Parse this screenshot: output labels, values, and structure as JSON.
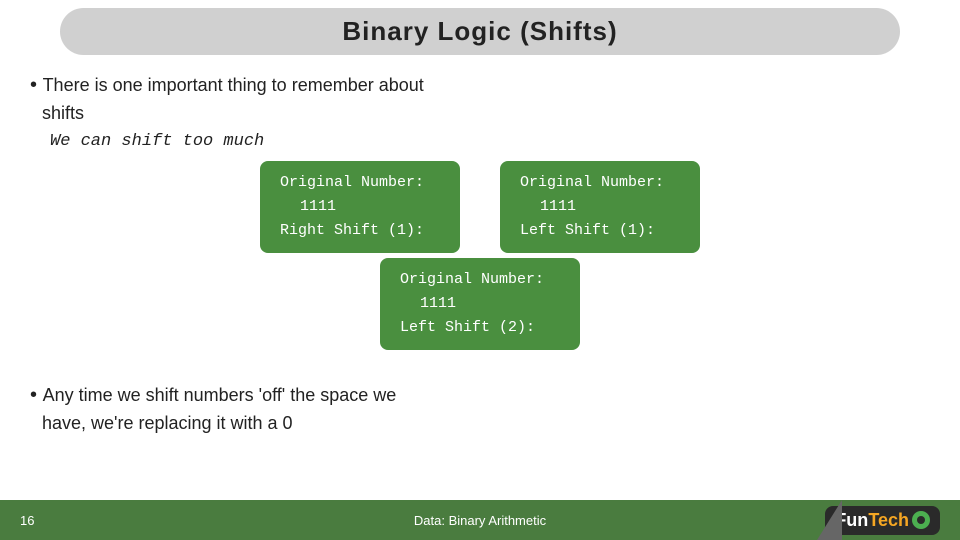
{
  "title": "Binary Logic  (Shifts)",
  "bullet1_line1": "There is one important thing to remember about",
  "bullet1_line2": "shifts",
  "italic_line": "We can shift too much",
  "box1": {
    "line1": "Original Number:",
    "line2": "1111",
    "line3": "Right Shift (1):"
  },
  "box2": {
    "line1": "Original Number:",
    "line2": "1111",
    "line3": "Left Shift (1):"
  },
  "box3": {
    "line1": "Original Number:",
    "line2": "1111",
    "line3": "Left Shift (2):"
  },
  "bullet2_line1": "Any time we shift numbers 'off' the space we",
  "bullet2_line2": "have, we're replacing it with a 0",
  "footer": {
    "page_num": "16",
    "center_text": "Data: Binary Arithmetic"
  },
  "logo": {
    "fun": "Fun",
    "tech": "Tech"
  }
}
